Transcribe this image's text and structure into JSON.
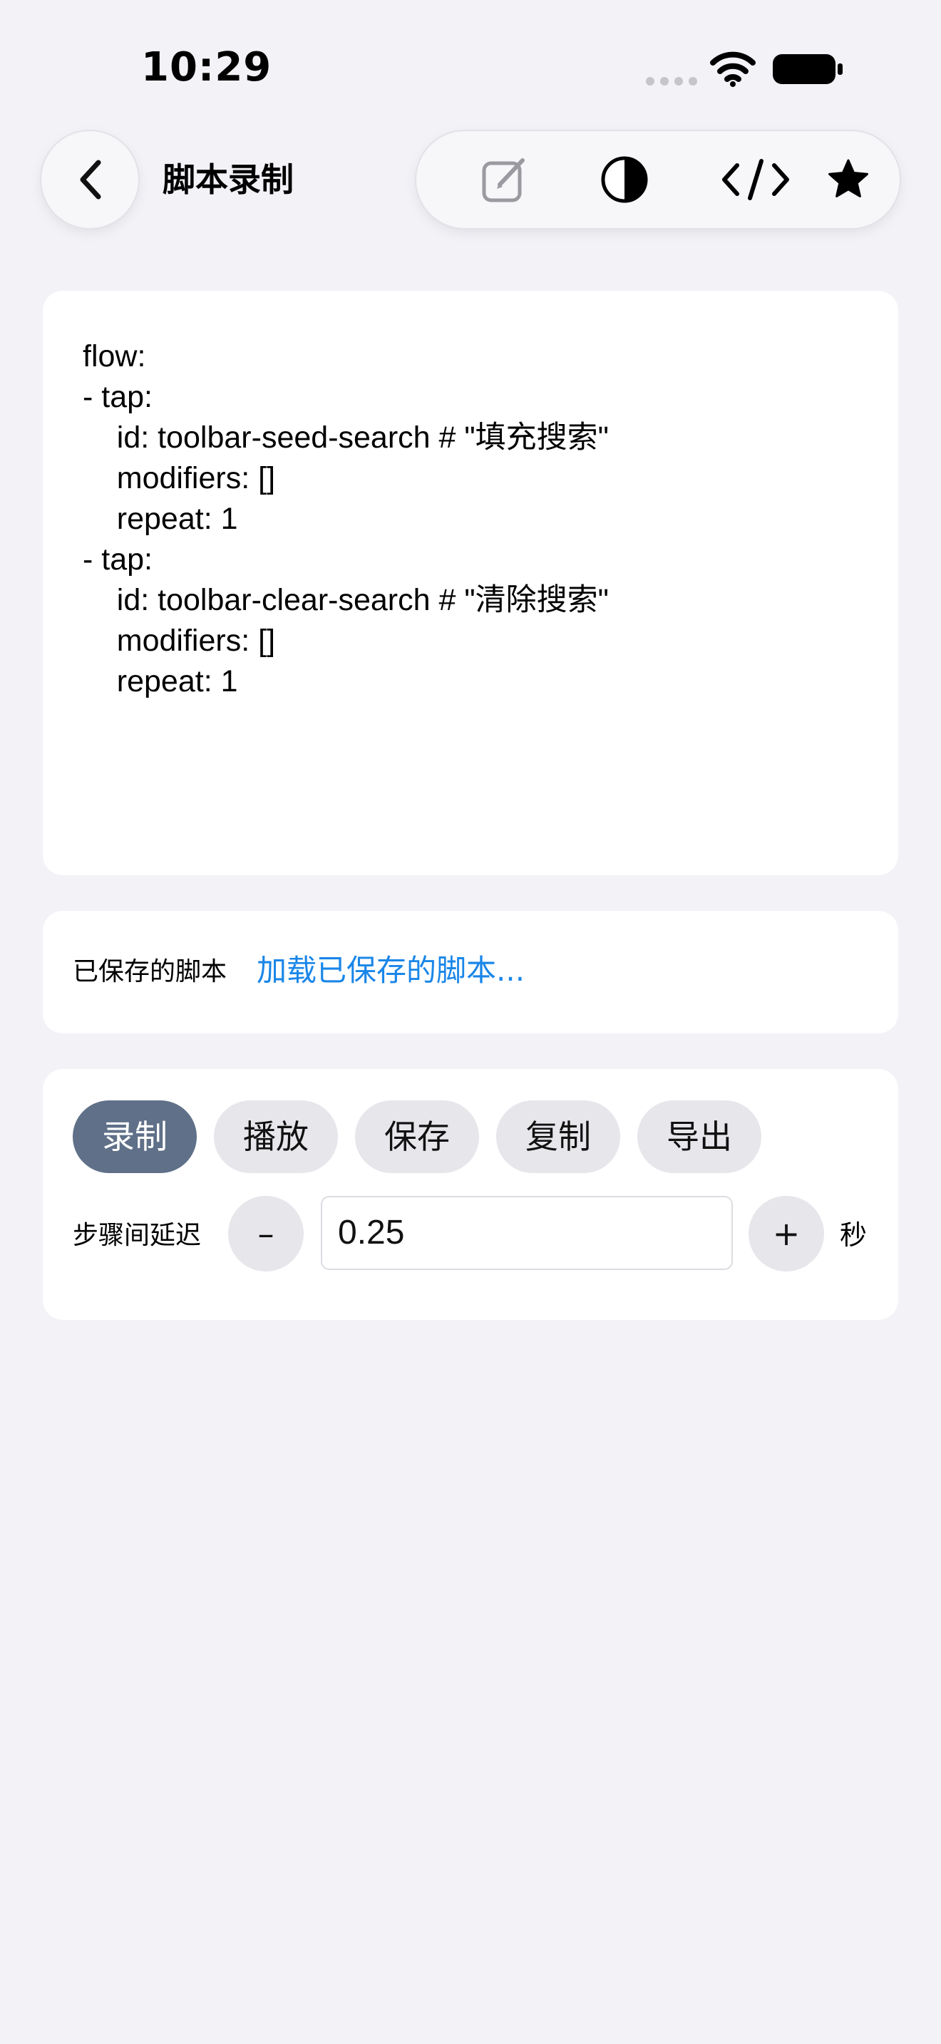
{
  "status_bar": {
    "time": "10:29"
  },
  "nav": {
    "title": "脚本录制",
    "back_icon": "chevron-left-icon",
    "toolbar_icons": [
      "edit-icon",
      "contrast-icon",
      "code-icon",
      "star-icon"
    ]
  },
  "editor": {
    "script_text": "flow:\n- tap:\n    id: toolbar-seed-search # \"填充搜索\"\n    modifiers: []\n    repeat: 1\n- tap:\n    id: toolbar-clear-search # \"清除搜索\"\n    modifiers: []\n    repeat: 1"
  },
  "saved": {
    "label": "已保存的脚本",
    "load_link": "加载已保存的脚本..."
  },
  "controls": {
    "buttons": [
      "录制",
      "播放",
      "保存",
      "复制",
      "导出"
    ],
    "active_button": "录制",
    "delay_label": "步骤间延迟",
    "decrement_label": "–",
    "delay_value": "0.25",
    "increment_label": "+",
    "unit": "秒"
  },
  "colors": {
    "background": "#f2f2f7",
    "accent_link": "#1a86e8",
    "active_chip": "#5f7088",
    "chip": "#e6e6eb"
  }
}
